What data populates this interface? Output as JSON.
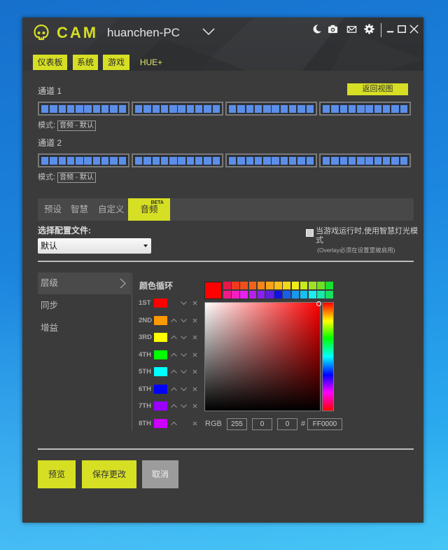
{
  "app": {
    "logo_text": "CAM",
    "device_name": "huanchen-PC",
    "accent_color": "#d6df24"
  },
  "window_controls": {
    "items": [
      "moon-icon",
      "camera-icon",
      "mail-icon",
      "gear-icon",
      "minimize-icon",
      "maximize-icon",
      "close-icon"
    ]
  },
  "nav": {
    "tabs": [
      {
        "label": "仪表板",
        "current": false
      },
      {
        "label": "系统",
        "current": false
      },
      {
        "label": "游戏",
        "current": false
      },
      {
        "label": "HUE+",
        "current": true
      }
    ]
  },
  "channels": {
    "back_button": "返回视图",
    "mode_label": "模式:",
    "led_color": "#5b8ee8",
    "items": [
      {
        "label": "通道 1",
        "mode": "音频 - 默认",
        "groups": [
          10,
          10,
          10,
          10
        ]
      },
      {
        "label": "通道 2",
        "mode": "音频 - 默认",
        "groups": [
          10,
          10,
          10,
          10
        ]
      }
    ]
  },
  "mode_tabs": [
    {
      "label": "预设",
      "active": false
    },
    {
      "label": "智慧",
      "active": false
    },
    {
      "label": "自定义",
      "active": false
    },
    {
      "label": "音频",
      "badge": "BETA",
      "active": true
    }
  ],
  "profile": {
    "label": "选择配置文件:",
    "selected": "默认"
  },
  "game_option": {
    "checked": false,
    "label": "当游戏运行时,使用智慧灯光模式",
    "note": "(Overlay必须在设置里被启用)"
  },
  "settings_list": [
    {
      "label": "层级",
      "active": true
    },
    {
      "label": "同步",
      "active": false
    },
    {
      "label": "增益",
      "active": false
    }
  ],
  "color_cycle": {
    "title": "颜色循环",
    "entries": [
      {
        "label": "1ST",
        "color": "#ff0000",
        "up": false,
        "down": true
      },
      {
        "label": "2ND",
        "color": "#ff9900",
        "up": true,
        "down": true
      },
      {
        "label": "3RD",
        "color": "#ffff00",
        "up": true,
        "down": true
      },
      {
        "label": "4TH",
        "color": "#00ff00",
        "up": true,
        "down": true
      },
      {
        "label": "5TH",
        "color": "#00ffff",
        "up": true,
        "down": true
      },
      {
        "label": "6TH",
        "color": "#0000ff",
        "up": true,
        "down": true
      },
      {
        "label": "7TH",
        "color": "#9900ff",
        "up": true,
        "down": true
      },
      {
        "label": "8TH",
        "color": "#cc00ff",
        "up": true,
        "down": false
      }
    ]
  },
  "color_picker": {
    "current": "#ff0000",
    "presets": [
      [
        "#e8174a",
        "#f03a1f",
        "#f04e1a",
        "#f06418",
        "#f88418",
        "#f8a418",
        "#f8c018",
        "#f0d818",
        "#f0ec18",
        "#c8e81c",
        "#a0e024",
        "#6ce024",
        "#18e030"
      ],
      [
        "#f01a8c",
        "#f020c0",
        "#e820f0",
        "#b820f0",
        "#8c20f0",
        "#6020e0",
        "#1010e8",
        "#1860e8",
        "#1898f0",
        "#18c0f0",
        "#18f0f0",
        "#18e8a8",
        "#18e060"
      ]
    ],
    "hue_color": "#ff0000",
    "saturation": 1.0,
    "brightness": 1.0,
    "rgb_label": "RGB",
    "r": "255",
    "g": "0",
    "b": "0",
    "hash_label": "#",
    "hex": "FF0000"
  },
  "actions": {
    "preview": "预览",
    "save": "保存更改",
    "cancel": "取消"
  }
}
